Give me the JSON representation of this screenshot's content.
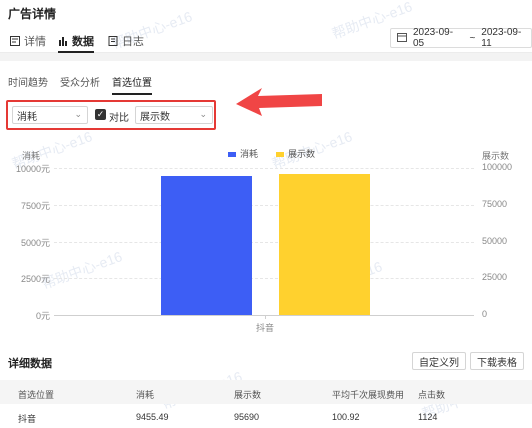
{
  "page_title": "广告详情",
  "tabs": [
    {
      "label": "详情",
      "icon": "detail-icon"
    },
    {
      "label": "数据",
      "icon": "bar-chart-icon"
    },
    {
      "label": "日志",
      "icon": "log-icon"
    }
  ],
  "date_range": {
    "start": "2023-09-05",
    "separator": "~",
    "end": "2023-09-11",
    "icon": "calendar-icon"
  },
  "sub_tabs": [
    "时间趋势",
    "受众分析",
    "首选位置"
  ],
  "controls": {
    "metric": "消耗",
    "compare_label": "对比",
    "compare_checked": true,
    "compare_metric": "展示数"
  },
  "legend": [
    {
      "label": "消耗",
      "color": "#3d5ef5"
    },
    {
      "label": "展示数",
      "color": "#ffd12e"
    }
  ],
  "chart_data": {
    "type": "bar",
    "categories": [
      "抖音"
    ],
    "series": [
      {
        "name": "消耗",
        "values": [
          9455.49
        ],
        "color": "#3d5ef5",
        "axis": "left"
      },
      {
        "name": "展示数",
        "values": [
          95690
        ],
        "color": "#ffd12e",
        "axis": "right"
      }
    ],
    "ylabel_left": "消耗",
    "ylabel_right": "展示数",
    "yticks_left": [
      "10000元",
      "7500元",
      "5000元",
      "2500元",
      "0元"
    ],
    "yticks_right": [
      "100000",
      "75000",
      "50000",
      "25000",
      "0"
    ],
    "ylim_left": [
      0,
      10000
    ],
    "ylim_right": [
      0,
      100000
    ],
    "grid": true,
    "legend_position": "top-center"
  },
  "detail": {
    "title": "详细数据",
    "buttons": {
      "custom_columns": "自定义列",
      "download": "下载表格"
    },
    "columns": [
      "首选位置",
      "消耗",
      "展示数",
      "平均千次展现费用",
      "点击数"
    ],
    "rows": [
      [
        "抖音",
        "9455.49",
        "95690",
        "100.92",
        "1124"
      ]
    ]
  },
  "watermark": "帮助中心-e16"
}
